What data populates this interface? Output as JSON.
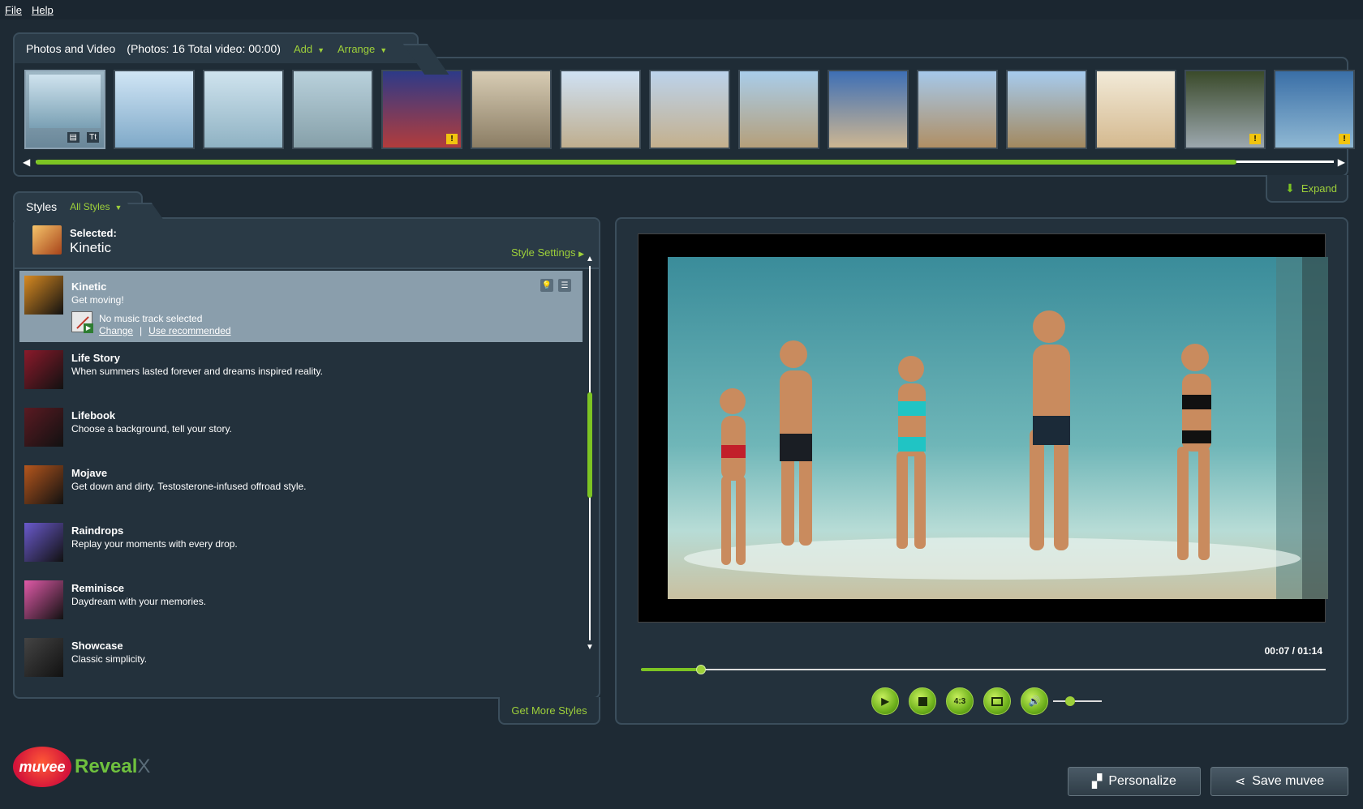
{
  "menu": {
    "file": "File",
    "help": "Help"
  },
  "photos": {
    "title": "Photos and Video",
    "stats": "(Photos: 16   Total video: 00:00)",
    "add": "Add",
    "arrange": "Arrange",
    "expand": "Expand",
    "thumbnails": [
      {
        "colors": [
          "#9fb8c6",
          "#6a8799"
        ],
        "selected": true,
        "badges": "Tt"
      },
      {
        "colors": [
          "#d0e5f5",
          "#7fa9c8"
        ]
      },
      {
        "colors": [
          "#cfe3ee",
          "#8fb2c3"
        ]
      },
      {
        "colors": [
          "#b9d1dc",
          "#86a0a9"
        ]
      },
      {
        "colors": [
          "#2d3a88",
          "#b23c3c"
        ],
        "warning": true
      },
      {
        "colors": [
          "#d7ccb4",
          "#8b7d64"
        ]
      },
      {
        "colors": [
          "#cfe1f4",
          "#bfae8e"
        ]
      },
      {
        "colors": [
          "#bcd3ec",
          "#c4b08d"
        ]
      },
      {
        "colors": [
          "#a9cdea",
          "#b59f7a"
        ]
      },
      {
        "colors": [
          "#3e6fb5",
          "#cdb692"
        ]
      },
      {
        "colors": [
          "#a5c8ea",
          "#b08f64"
        ]
      },
      {
        "colors": [
          "#a6cbee",
          "#a3895f"
        ]
      },
      {
        "colors": [
          "#f2ead8",
          "#d4b98f"
        ]
      },
      {
        "colors": [
          "#3a4a2a",
          "#9ca7ae"
        ],
        "warning": true
      },
      {
        "colors": [
          "#3a6fa7",
          "#8fb8d3"
        ],
        "warning": true
      }
    ]
  },
  "styles": {
    "tab_label": "Styles",
    "filter": "All Styles",
    "selected_label": "Selected:",
    "selected_name": "Kinetic",
    "style_settings": "Style Settings",
    "get_more": "Get More Styles",
    "items": [
      {
        "name": "Kinetic",
        "desc": "Get moving!",
        "color": "#d88a22",
        "active": true,
        "music_status": "No music track selected",
        "change": "Change",
        "use_recommended": "Use recommended"
      },
      {
        "name": "Life Story",
        "desc": "When summers lasted forever and dreams inspired reality.",
        "color": "#8b1a2b"
      },
      {
        "name": "Lifebook",
        "desc": "Choose a background, tell your story.",
        "color": "#5a1a22"
      },
      {
        "name": "Mojave",
        "desc": "Get down and dirty. Testosterone-infused offroad style.",
        "color": "#b5561d"
      },
      {
        "name": "Raindrops",
        "desc": "Replay your moments with every drop.",
        "color": "#6a5acd"
      },
      {
        "name": "Reminisce",
        "desc": "Daydream with your memories.",
        "color": "#e05aa8"
      },
      {
        "name": "Showcase",
        "desc": "Classic simplicity.",
        "color": "#444444"
      }
    ]
  },
  "preview": {
    "time": "00:07 / 01:14",
    "progress": 0.088,
    "volume": 0.35,
    "aspect": "4:3"
  },
  "logo": {
    "brand": "muvee",
    "product": "Reveal",
    "suffix": "X"
  },
  "actions": {
    "personalize": "Personalize",
    "save": "Save muvee"
  },
  "colors": {
    "accent": "#7cc423",
    "link": "#9ed03a",
    "background": "#1e2a34"
  }
}
